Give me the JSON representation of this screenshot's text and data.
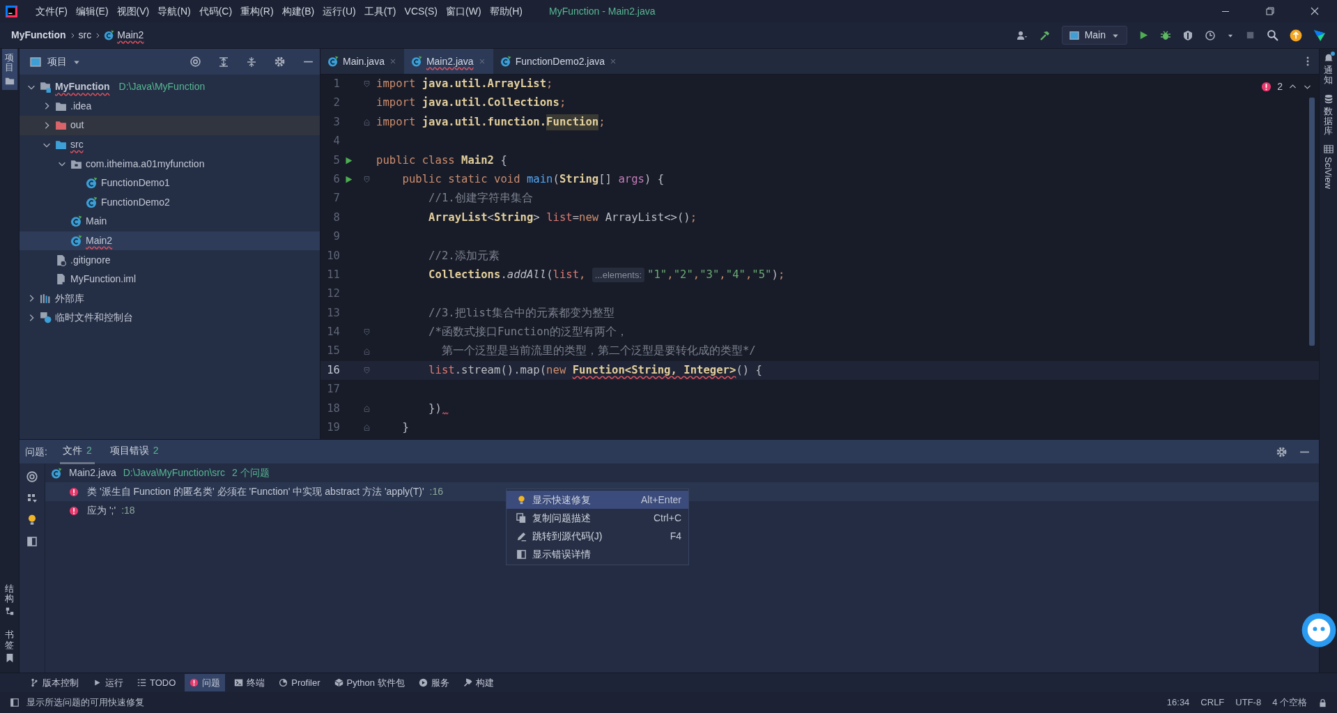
{
  "title_bar": {
    "menus": [
      "文件(F)",
      "编辑(E)",
      "视图(V)",
      "导航(N)",
      "代码(C)",
      "重构(R)",
      "构建(B)",
      "运行(U)",
      "工具(T)",
      "VCS(S)",
      "窗口(W)",
      "帮助(H)"
    ],
    "title": "MyFunction - Main2.java"
  },
  "nav_bar": {
    "breadcrumbs": [
      {
        "label": "MyFunction",
        "kind": "project",
        "error": false
      },
      {
        "label": "src",
        "kind": "folder",
        "error": false
      },
      {
        "label": "Main2",
        "kind": "class",
        "error": true
      }
    ],
    "run_config": "Main"
  },
  "left_strip": {
    "top": [
      {
        "label": "项目",
        "selected": true
      }
    ],
    "bottom": [
      {
        "label": "结构",
        "selected": false
      },
      {
        "label": "书签",
        "selected": false
      }
    ]
  },
  "project_panel": {
    "title": "项目",
    "tree": [
      {
        "label": "MyFunction",
        "kind": "module",
        "path": "D:\\Java\\MyFunction",
        "expanded": true,
        "selected": false,
        "hovered": false,
        "error": true,
        "children": [
          {
            "label": ".idea",
            "kind": "folder",
            "expanded": false,
            "selected": false,
            "hovered": false,
            "error": false
          },
          {
            "label": "out",
            "kind": "excluded-folder",
            "expanded": false,
            "selected": false,
            "hovered": true,
            "error": false
          },
          {
            "label": "src",
            "kind": "source-folder",
            "expanded": true,
            "selected": false,
            "hovered": false,
            "error": true,
            "children": [
              {
                "label": "com.itheima.a01myfunction",
                "kind": "package",
                "expanded": true,
                "selected": false,
                "hovered": false,
                "error": false,
                "children": [
                  {
                    "label": "FunctionDemo1",
                    "kind": "class",
                    "selected": false,
                    "hovered": false,
                    "error": false
                  },
                  {
                    "label": "FunctionDemo2",
                    "kind": "class",
                    "selected": false,
                    "hovered": false,
                    "error": false
                  }
                ]
              },
              {
                "label": "Main",
                "kind": "class",
                "selected": false,
                "hovered": false,
                "error": false
              },
              {
                "label": "Main2",
                "kind": "class",
                "selected": true,
                "hovered": false,
                "error": true
              }
            ]
          },
          {
            "label": ".gitignore",
            "kind": "ignore-file",
            "selected": false,
            "hovered": false,
            "error": false
          },
          {
            "label": "MyFunction.iml",
            "kind": "module-file",
            "selected": false,
            "hovered": false,
            "error": false
          }
        ]
      },
      {
        "label": "外部库",
        "kind": "library",
        "expanded": false,
        "selected": false,
        "hovered": false,
        "error": false
      },
      {
        "label": "临时文件和控制台",
        "kind": "scratch",
        "expanded": false,
        "selected": false,
        "hovered": false,
        "error": false
      }
    ]
  },
  "editor": {
    "tabs": [
      {
        "label": "Main.java",
        "selected": false,
        "error": false
      },
      {
        "label": "Main2.java",
        "selected": true,
        "error": true
      },
      {
        "label": "FunctionDemo2.java",
        "selected": false,
        "error": false
      }
    ],
    "error_count": "2",
    "lines": [
      {
        "number": "1",
        "fold_start": true,
        "current": false,
        "segments": [
          {
            "text": "import ",
            "kind": "keyword"
          },
          {
            "text": "java.util.ArrayList",
            "kind": "package"
          },
          {
            "text": ";",
            "kind": "keyword"
          }
        ]
      },
      {
        "number": "2",
        "current": false,
        "segments": [
          {
            "text": "import ",
            "kind": "keyword"
          },
          {
            "text": "java.util.Collections",
            "kind": "package"
          },
          {
            "text": ";",
            "kind": "keyword"
          }
        ]
      },
      {
        "number": "3",
        "fold_end": true,
        "current": false,
        "segments": [
          {
            "text": "import ",
            "kind": "keyword"
          },
          {
            "text": "java.util.function.",
            "kind": "package"
          },
          {
            "text": "Function",
            "kind": "highlight"
          },
          {
            "text": ";",
            "kind": "keyword"
          }
        ]
      },
      {
        "number": "4",
        "current": false
      },
      {
        "number": "5",
        "runnable": true,
        "current": false,
        "segments": [
          {
            "text": "public class ",
            "kind": "keyword"
          },
          {
            "text": "Main2",
            "kind": "type"
          },
          {
            "text": " {",
            "kind": "plain"
          }
        ]
      },
      {
        "number": "6",
        "runnable": true,
        "fold_start": true,
        "current": false,
        "segments": [
          {
            "text": "    public static void ",
            "kind": "keyword"
          },
          {
            "text": "main",
            "kind": "method"
          },
          {
            "text": "(",
            "kind": "plain"
          },
          {
            "text": "String",
            "kind": "type"
          },
          {
            "text": "[] ",
            "kind": "plain"
          },
          {
            "text": "args",
            "kind": "parameter"
          },
          {
            "text": ") {",
            "kind": "plain"
          }
        ]
      },
      {
        "number": "7",
        "current": false,
        "segments": [
          {
            "text": "        //1.创建字符串集合",
            "kind": "comment"
          }
        ]
      },
      {
        "number": "8",
        "current": false,
        "segments": [
          {
            "text": "        ArrayList",
            "kind": "type"
          },
          {
            "text": "<",
            "kind": "plain"
          },
          {
            "text": "String",
            "kind": "type"
          },
          {
            "text": "> ",
            "kind": "plain"
          },
          {
            "text": "list",
            "kind": "variable"
          },
          {
            "text": "=",
            "kind": "plain"
          },
          {
            "text": "new ",
            "kind": "keyword"
          },
          {
            "text": "ArrayList<>()",
            "kind": "plain"
          },
          {
            "text": ";",
            "kind": "keyword"
          }
        ]
      },
      {
        "number": "9",
        "current": false
      },
      {
        "number": "10",
        "current": false,
        "segments": [
          {
            "text": "        //2.添加元素",
            "kind": "comment"
          }
        ]
      },
      {
        "number": "11",
        "current": false,
        "segments": [
          {
            "text": "        Collections",
            "kind": "type"
          },
          {
            "text": ".",
            "kind": "plain"
          },
          {
            "text": "addAll",
            "kind": "static"
          },
          {
            "text": "(",
            "kind": "plain"
          },
          {
            "text": "list",
            "kind": "variable"
          },
          {
            "text": ", ",
            "kind": "keyword"
          },
          {
            "text": "...elements:",
            "kind": "hint"
          },
          {
            "text": "\"1\"",
            "kind": "string"
          },
          {
            "text": ",",
            "kind": "keyword"
          },
          {
            "text": "\"2\"",
            "kind": "string"
          },
          {
            "text": ",",
            "kind": "keyword"
          },
          {
            "text": "\"3\"",
            "kind": "string"
          },
          {
            "text": ",",
            "kind": "keyword"
          },
          {
            "text": "\"4\"",
            "kind": "string"
          },
          {
            "text": ",",
            "kind": "keyword"
          },
          {
            "text": "\"5\"",
            "kind": "string"
          },
          {
            "text": ")",
            "kind": "plain"
          },
          {
            "text": ";",
            "kind": "keyword"
          }
        ]
      },
      {
        "number": "12",
        "current": false
      },
      {
        "number": "13",
        "current": false,
        "segments": [
          {
            "text": "        //3.把list集合中的元素都变为整型",
            "kind": "comment"
          }
        ]
      },
      {
        "number": "14",
        "fold_start": true,
        "current": false,
        "segments": [
          {
            "text": "        /*函数式接口Function的泛型有两个，",
            "kind": "comment"
          }
        ]
      },
      {
        "number": "15",
        "fold_end": true,
        "current": false,
        "segments": [
          {
            "text": "          第一个泛型是当前流里的类型，第二个泛型是要转化成的类型*/",
            "kind": "comment"
          }
        ]
      },
      {
        "number": "16",
        "fold_start": true,
        "current": true,
        "segments": [
          {
            "text": "        list",
            "kind": "variable"
          },
          {
            "text": ".stream().map(",
            "kind": "plain"
          },
          {
            "text": "new ",
            "kind": "keyword"
          },
          {
            "text": "Function<String, Integer>",
            "kind": "type",
            "error": true
          },
          {
            "text": "() {",
            "kind": "plain"
          }
        ]
      },
      {
        "number": "17",
        "current": false
      },
      {
        "number": "18",
        "fold_end": true,
        "current": false,
        "trailing_error": true,
        "segments": [
          {
            "text": "        })",
            "kind": "plain"
          }
        ]
      },
      {
        "number": "19",
        "fold_end": true,
        "current": false,
        "segments": [
          {
            "text": "    }",
            "kind": "plain"
          }
        ]
      }
    ]
  },
  "right_strip": [
    {
      "label": "通知",
      "kind": "bell",
      "unread": true
    },
    {
      "label": "数据库",
      "kind": "database",
      "unread": false
    },
    {
      "label": "SciView",
      "kind": "grid",
      "unread": false
    }
  ],
  "problems": {
    "label": "问题:",
    "tabs": [
      {
        "label": "文件",
        "count": "2",
        "selected": true
      },
      {
        "label": "项目错误",
        "count": "2",
        "selected": false
      }
    ],
    "file": {
      "name": "Main2.java",
      "path": "D:\\Java\\MyFunction\\src",
      "count": "2 个问题"
    },
    "items": [
      {
        "text": "类 '派生自 Function 的匿名类' 必须在 'Function' 中实现 abstract 方法 'apply(T)'",
        "line": ":16",
        "selected": true
      },
      {
        "text": "应为 ';'",
        "line": ":18",
        "selected": false
      }
    ],
    "context_menu": [
      {
        "label": "显示快速修复",
        "shortcut": "Alt+Enter",
        "kind": "bulb",
        "selected": true
      },
      {
        "label": "复制问题描述",
        "shortcut": "Ctrl+C",
        "kind": "copy",
        "selected": false
      },
      {
        "label": "跳转到源代码(J)",
        "shortcut": "F4",
        "kind": "edit",
        "selected": false
      },
      {
        "label": "显示错误详情",
        "kind": "panel",
        "selected": false
      }
    ]
  },
  "tool_windows": [
    {
      "label": "版本控制",
      "kind": "vcs",
      "selected": false
    },
    {
      "label": "运行",
      "kind": "run",
      "selected": false
    },
    {
      "label": "TODO",
      "kind": "todo",
      "selected": false
    },
    {
      "label": "问题",
      "kind": "problems",
      "selected": true
    },
    {
      "label": "终端",
      "kind": "terminal",
      "selected": false
    },
    {
      "label": "Profiler",
      "kind": "profiler",
      "selected": false
    },
    {
      "label": "Python 软件包",
      "kind": "python",
      "selected": false
    },
    {
      "label": "服务",
      "kind": "services",
      "selected": false
    },
    {
      "label": "构建",
      "kind": "build",
      "selected": false
    }
  ],
  "status_bar": {
    "message": "显示所选问题的可用快速修复",
    "items": [
      "16:34",
      "CRLF",
      "UTF-8",
      "4 个空格"
    ]
  }
}
